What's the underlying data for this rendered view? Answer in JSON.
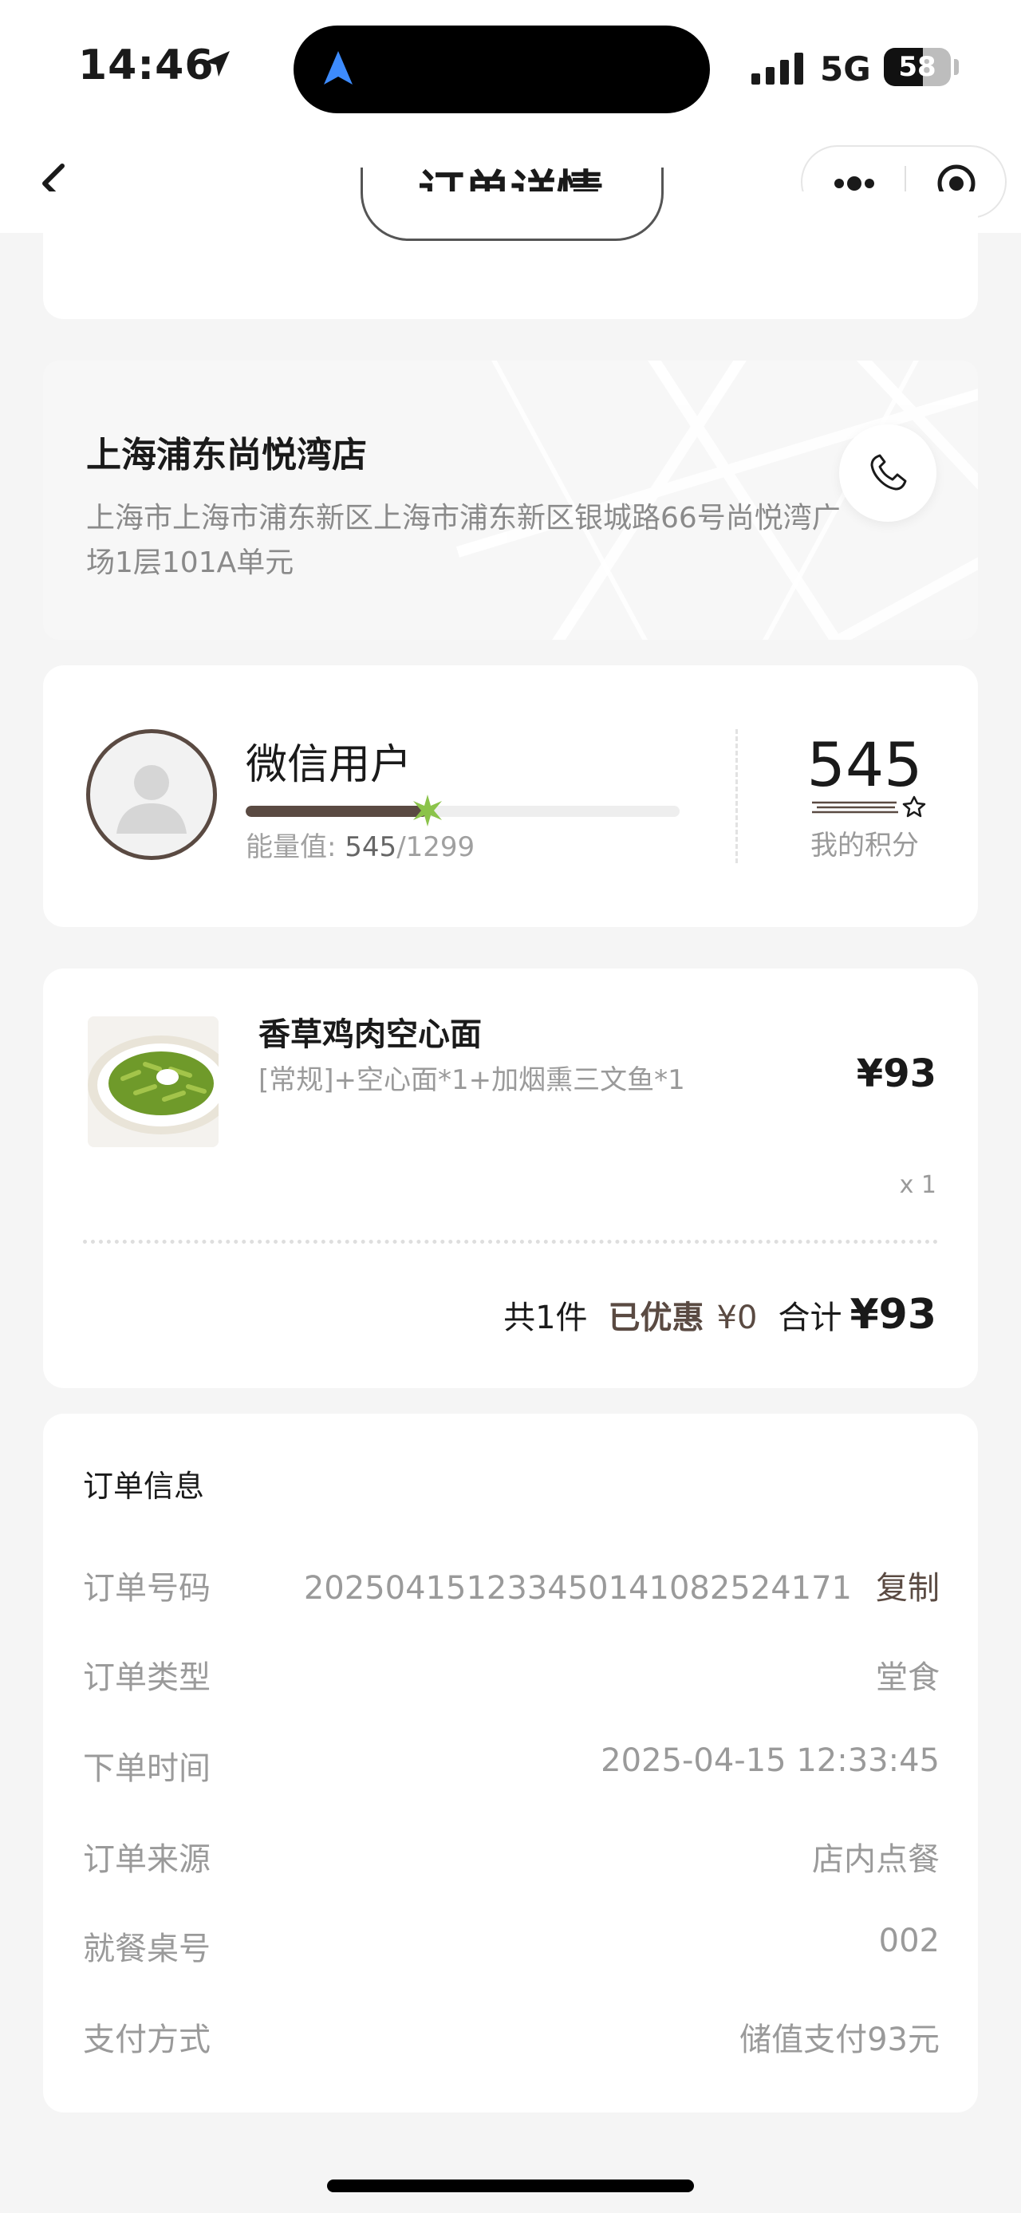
{
  "status_bar": {
    "time": "14:46",
    "network": "5G",
    "battery": "58",
    "battery_level": 0.58
  },
  "nav": {
    "title": "订单详情"
  },
  "store": {
    "name": "上海浦东尚悦湾店",
    "address": "上海市上海市浦东新区上海市浦东新区银城路66号尚悦湾广场1层101A单元"
  },
  "member": {
    "name": "微信用户",
    "energy_label": "能量值:",
    "energy_current": "545",
    "energy_max": "/1299",
    "energy_ratio": 0.42,
    "points_value": "545",
    "points_label": "我的积分"
  },
  "order_item": {
    "name": "香草鸡肉空心面",
    "spec": "[常规]+空心面*1+加烟熏三文鱼*1",
    "price": "¥93",
    "qty": "x 1",
    "summary": {
      "count": "共1件",
      "discount_label": "已优惠",
      "discount_value": "¥0",
      "total_label": "合计",
      "total_value": "¥93"
    }
  },
  "order_info": {
    "title": "订单信息",
    "copy_label": "复制",
    "rows": [
      {
        "label": "订单号码",
        "value": "2025041512334501410825241​71"
      },
      {
        "label": "订单类型",
        "value": "堂食"
      },
      {
        "label": "下单时间",
        "value": "2025-04-15 12:33:45"
      },
      {
        "label": "订单来源",
        "value": "店内点餐"
      },
      {
        "label": "就餐桌号",
        "value": "002"
      },
      {
        "label": "支付方式",
        "value": "储值支付93元"
      }
    ]
  },
  "colors": {
    "accent": "#5a4a42",
    "muted_text": "#9a9a9a",
    "background": "#f5f5f5",
    "energy_spark": "#8bc34a"
  }
}
